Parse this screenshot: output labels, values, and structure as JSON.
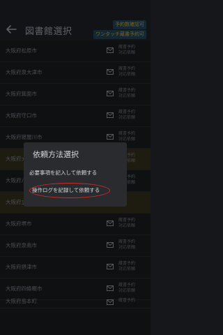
{
  "header": {
    "title": "図書館選択",
    "badge_reserve": "予約数確認可",
    "badge_one_touch": "ワンタッチ蔵書予約可"
  },
  "list": {
    "action_line1": "蔵書予約",
    "action_line2": "対応依頼",
    "rows": [
      {
        "name": "大阪府松原市"
      },
      {
        "name": "大阪府泉大津市"
      },
      {
        "name": "大阪府箕面市"
      },
      {
        "name": "大阪府守口市"
      },
      {
        "name": "大阪府寝屋川市"
      },
      {
        "name": "大阪府大東市"
      },
      {
        "name": "大阪府八尾市"
      },
      {
        "name": "大阪府立図書館"
      },
      {
        "name": "大阪府堺市"
      },
      {
        "name": "大阪府泉南市"
      },
      {
        "name": "大阪府摂津市"
      },
      {
        "name": "大阪府四條畷市"
      },
      {
        "name": "大阪府島本町"
      }
    ]
  },
  "dialog": {
    "title": "依頼方法選択",
    "option_fill": "必要事項を記入して依頼する",
    "option_log": "操作ログを記録して依頼する"
  },
  "colors": {
    "background": "#16171a",
    "highlight_row": "#2c2819",
    "badge_text": "#b08a25",
    "annotation_red": "#d22a2a"
  }
}
